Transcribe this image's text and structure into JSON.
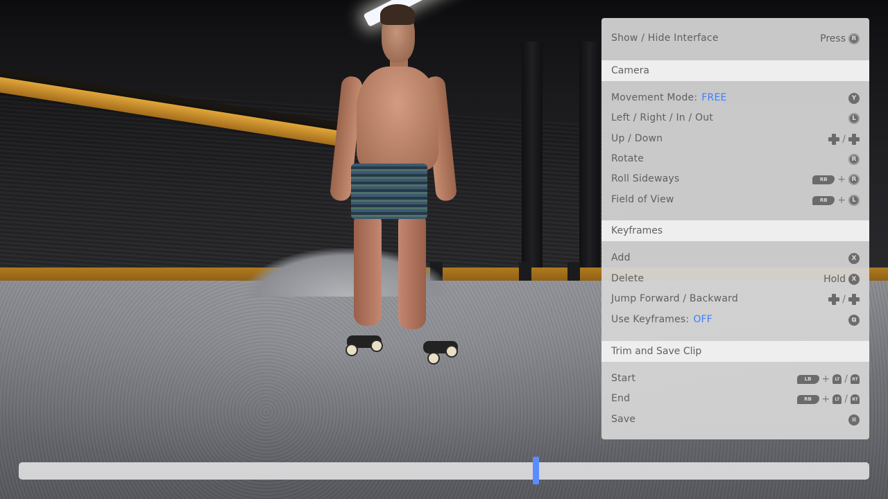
{
  "panel": {
    "toggle": {
      "label": "Show / Hide Interface",
      "prefix": "Press",
      "button": "R"
    },
    "camera": {
      "header": "Camera",
      "movement_mode": {
        "label": "Movement Mode:",
        "value": "FREE",
        "button": "Y"
      },
      "move": {
        "label": "Left / Right / In / Out",
        "button": "L"
      },
      "up_down": {
        "label": "Up / Down",
        "separator": "/"
      },
      "rotate": {
        "label": "Rotate",
        "button": "R"
      },
      "roll": {
        "label": "Roll Sideways",
        "bumper": "RB",
        "plus": "+",
        "button": "R"
      },
      "fov": {
        "label": "Field of View",
        "bumper": "RB",
        "plus": "+",
        "button": "L"
      }
    },
    "keyframes": {
      "header": "Keyframes",
      "add": {
        "label": "Add",
        "button": "X"
      },
      "delete": {
        "label": "Delete",
        "prefix": "Hold",
        "button": "X"
      },
      "jump": {
        "label": "Jump Forward / Backward",
        "separator": "/"
      },
      "use": {
        "label": "Use Keyframes:",
        "value": "OFF",
        "button": "⧉"
      }
    },
    "trim": {
      "header": "Trim and Save Clip",
      "start": {
        "label": "Start",
        "bumper": "LB",
        "plus": "+",
        "trigger1": "LT",
        "separator": "/",
        "trigger2": "RT"
      },
      "end": {
        "label": "End",
        "bumper": "RB",
        "plus": "+",
        "trigger1": "LT",
        "separator": "/",
        "trigger2": "RT"
      },
      "save": {
        "label": "Save",
        "button": "≡"
      }
    }
  },
  "timeline": {
    "position": 0.608
  },
  "colors": {
    "accent": "#3d7dff",
    "scrubber": "#5b8cff",
    "panel": "#d6d6d6",
    "section": "#eeeeee"
  }
}
